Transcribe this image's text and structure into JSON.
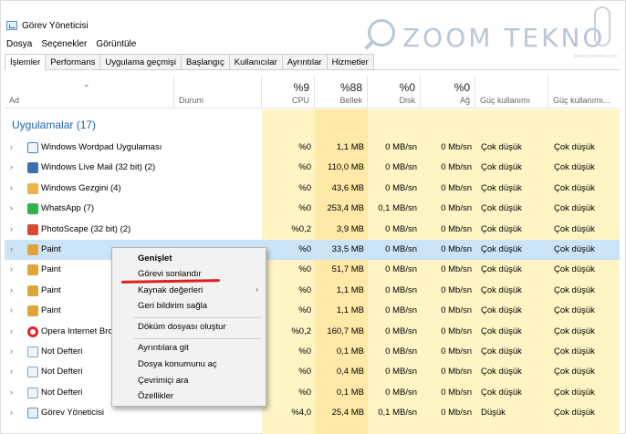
{
  "window": {
    "title": "Görev Yöneticisi"
  },
  "watermark": {
    "text": "ZOOM TEKNO",
    "sub": "www.zoomtekno.com"
  },
  "menu": [
    "Dosya",
    "Seçenekler",
    "Görüntüle"
  ],
  "tabs": [
    "İşlemler",
    "Performans",
    "Uygulama geçmişi",
    "Başlangıç",
    "Kullanıcılar",
    "Ayrıntılar",
    "Hizmetler"
  ],
  "header": {
    "name": "Ad",
    "status": "Durum",
    "cpu_pct": "%9",
    "cpu": "CPU",
    "mem_pct": "%88",
    "mem": "Bellek",
    "disk_pct": "%0",
    "disk": "Disk",
    "net_pct": "%0",
    "net": "Ağ",
    "power": "Güç kullanımı",
    "power_trend": "Güç kullanımı..."
  },
  "group": {
    "label": "Uygulamalar (17)"
  },
  "colors": {
    "accent": "#1e63b7",
    "selected": "#cce4f7",
    "cell_yellow": "#fff4c4",
    "cell_yellow_strong": "#ffe9a6",
    "red": "#e02020"
  },
  "rows": [
    {
      "name": "Windows Wordpad Uygulaması",
      "icon": "wordpad-icon",
      "cpu": "%0",
      "mem": "1,1 MB",
      "disk": "0 MB/sn",
      "net": "0 Mb/sn",
      "power": "Çok düşük",
      "power_trend": "Çok düşük"
    },
    {
      "name": "Windows Live Mail (32 bit) (2)",
      "icon": "mail-icon",
      "cpu": "%0",
      "mem": "110,0 MB",
      "disk": "0 MB/sn",
      "net": "0 Mb/sn",
      "power": "Çok düşük",
      "power_trend": "Çok düşük"
    },
    {
      "name": "Windows Gezgini (4)",
      "icon": "folder-icon",
      "cpu": "%0",
      "mem": "43,6 MB",
      "disk": "0 MB/sn",
      "net": "0 Mb/sn",
      "power": "Çok düşük",
      "power_trend": "Çok düşük"
    },
    {
      "name": "WhatsApp (7)",
      "icon": "whatsapp-icon",
      "cpu": "%0",
      "mem": "253,4 MB",
      "disk": "0,1 MB/sn",
      "net": "0 Mb/sn",
      "power": "Çok düşük",
      "power_trend": "Çok düşük"
    },
    {
      "name": "PhotoScape (32 bit) (2)",
      "icon": "photoscape-icon",
      "cpu": "%0,2",
      "mem": "3,9 MB",
      "disk": "0 MB/sn",
      "net": "0 Mb/sn",
      "power": "Çok düşük",
      "power_trend": "Çok düşük"
    },
    {
      "name": "Paint",
      "icon": "paint-icon",
      "cpu": "%0",
      "mem": "33,5 MB",
      "disk": "0 MB/sn",
      "net": "0 Mb/sn",
      "power": "Çok düşük",
      "power_trend": "Çok düşük",
      "selected": true
    },
    {
      "name": "Paint",
      "icon": "paint-icon",
      "cpu": "%0",
      "mem": "51,7 MB",
      "disk": "0 MB/sn",
      "net": "0 Mb/sn",
      "power": "Çok düşük",
      "power_trend": "Çok düşük"
    },
    {
      "name": "Paint",
      "icon": "paint-icon",
      "cpu": "%0",
      "mem": "1,1 MB",
      "disk": "0 MB/sn",
      "net": "0 Mb/sn",
      "power": "Çok düşük",
      "power_trend": "Çok düşük"
    },
    {
      "name": "Paint",
      "icon": "paint-icon",
      "cpu": "%0",
      "mem": "1,1 MB",
      "disk": "0 MB/sn",
      "net": "0 Mb/sn",
      "power": "Çok düşük",
      "power_trend": "Çok düşük"
    },
    {
      "name": "Opera Internet Bro",
      "icon": "opera-icon",
      "cpu": "%0,2",
      "mem": "160,7 MB",
      "disk": "0 MB/sn",
      "net": "0 Mb/sn",
      "power": "Çok düşük",
      "power_trend": "Çok düşük"
    },
    {
      "name": "Not Defteri",
      "icon": "notepad-icon",
      "cpu": "%0",
      "mem": "0,1 MB",
      "disk": "0 MB/sn",
      "net": "0 Mb/sn",
      "power": "Çok düşük",
      "power_trend": "Çok düşük"
    },
    {
      "name": "Not Defteri",
      "icon": "notepad-icon",
      "cpu": "%0",
      "mem": "0,4 MB",
      "disk": "0 MB/sn",
      "net": "0 Mb/sn",
      "power": "Çok düşük",
      "power_trend": "Çok düşük"
    },
    {
      "name": "Not Defteri",
      "icon": "notepad-icon",
      "cpu": "%0",
      "mem": "0,1 MB",
      "disk": "0 MB/sn",
      "net": "0 Mb/sn",
      "power": "Çok düşük",
      "power_trend": "Çok düşük"
    },
    {
      "name": "Görev Yöneticisi",
      "icon": "taskmgr-icon",
      "cpu": "%4,0",
      "mem": "25,4 MB",
      "disk": "0,1 MB/sn",
      "net": "0 Mb/sn",
      "power": "Düşük",
      "power_trend": "Çok düşük"
    }
  ],
  "context_menu": {
    "items": [
      "Genişlet",
      "Görevi sonlandır",
      "Kaynak değerleri",
      "Geri bildirim sağla",
      "Döküm dosyası oluştur",
      "Ayrıntılara git",
      "Dosya konumunu aç",
      "Çevrimiçi ara",
      "Özellikler"
    ]
  }
}
